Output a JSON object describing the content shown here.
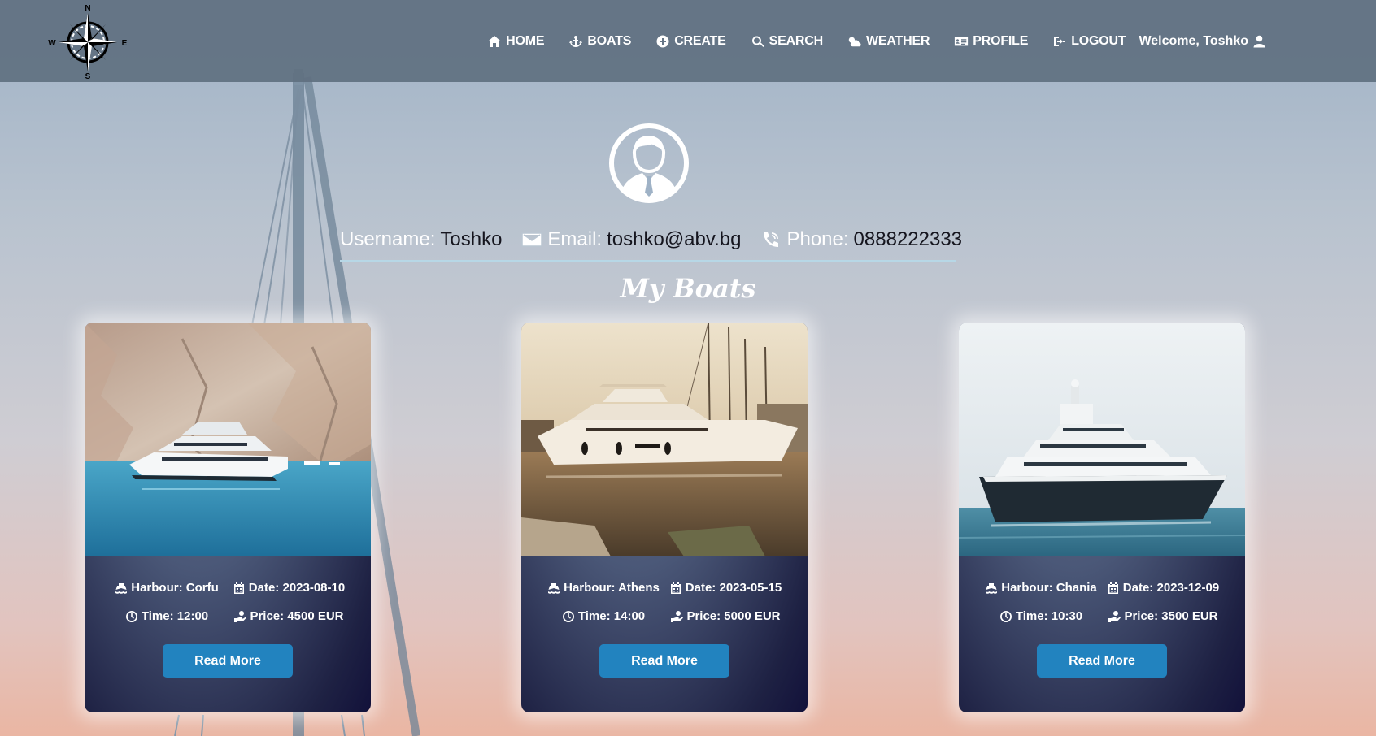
{
  "nav": {
    "logo_letters": {
      "n": "N",
      "e": "E",
      "s": "S",
      "w": "W"
    },
    "items": [
      {
        "label": "HOME",
        "icon": "home-icon"
      },
      {
        "label": "BOATS",
        "icon": "anchor-icon"
      },
      {
        "label": "CREATE",
        "icon": "plus-circle-icon"
      },
      {
        "label": "SEARCH",
        "icon": "search-icon"
      },
      {
        "label": "WEATHER",
        "icon": "cloud-sun-icon"
      },
      {
        "label": "PROFILE",
        "icon": "id-card-icon"
      },
      {
        "label": "LOGOUT",
        "icon": "logout-icon"
      }
    ],
    "welcome": "Welcome, Toshko"
  },
  "profile": {
    "username_label": "Username:",
    "username": "Toshko",
    "email_label": "Email:",
    "email": "toshko@abv.bg",
    "phone_label": "Phone:",
    "phone": "0888222333"
  },
  "section_title": "My Boats",
  "boats": [
    {
      "harbour": "Harbour: Corfu",
      "date": "Date: 2023-08-10",
      "time": "Time: 12:00",
      "price": "Price: 4500 EUR",
      "button": "Read More"
    },
    {
      "harbour": "Harbour: Athens",
      "date": "Date: 2023-05-15",
      "time": "Time: 14:00",
      "price": "Price: 5000 EUR",
      "button": "Read More"
    },
    {
      "harbour": "Harbour: Chania",
      "date": "Date: 2023-12-09",
      "time": "Time: 10:30",
      "price": "Price: 3500 EUR",
      "button": "Read More"
    }
  ],
  "colors": {
    "navbar": "#607080",
    "button": "#2283bf",
    "card_dark": "#12113a",
    "divider": "#b7d7e6"
  }
}
